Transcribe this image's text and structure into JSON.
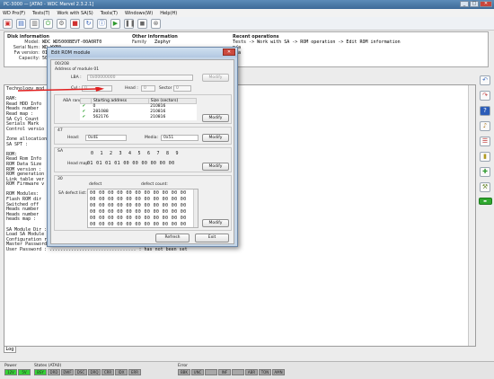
{
  "app": {
    "title": "PC-3000 — [ATA0 - WDC Marvel 2.3.2.1]",
    "menu": [
      "WD Pro(F)",
      "Tests(T)",
      "Work with SA(S)",
      "Tools(T)",
      "Windows(W)",
      "Help(H)"
    ]
  },
  "info_panel": {
    "disk_header": "Disk information",
    "model_label": "Model:",
    "model_value": "WDC WD5000BEVT-00A0RT0",
    "serial_label": "Serial Num:",
    "serial_value": "WD-WXE0...",
    "fw_label": "Fw version:",
    "fw_value": "01.01A01",
    "capacity_label": "Capacity:",
    "capacity_value": "500 GB",
    "other_header": "Other information",
    "family_label": "Family",
    "family_value": "Zephyr",
    "recent_header": "Recent operations",
    "recent_line1": "Tests -> Work with SA -> ROM operation -> Edit ROM information",
    "recent_line2": "n/a",
    "recent_line3": "n/a"
  },
  "log_lines": [
    "Technology mod",
    "",
    "RAM:",
    "Read HDD Info",
    "Heads number",
    "Read map :",
    "SA Cyl Count",
    "Serials Mark",
    "Control versio",
    "",
    "Zone allocation",
    "SA SPT :",
    "",
    "ROM:",
    "Read Rom Info",
    "ROM Data Size",
    "ROM version :",
    "ROM generation",
    "Link table ver",
    "ROM Firmware v",
    "",
    "ROM Modules:",
    "Flash ROM dir",
    "Switched off",
    "Heads number",
    "Heads number",
    "heads map :",
    "",
    "SA Module Dir : ................................ : OK",
    "Load SA Module Dir ............................. : OK",
    "Configuration reading : ........................ : OK",
    "Master Password : .............................. : has not been set",
    "User Password : ................................ : has not been set"
  ],
  "dialog": {
    "title": "Edit ROM module",
    "module_path": "00/208",
    "address_caption": "Address of module 01",
    "lba_label": "LBA :",
    "lba_value": "0x00000000",
    "cyl_label": "Cyl :",
    "cyl_value": "0",
    "head_label": "Head :",
    "head_value": "0",
    "sector_label": "Sector :",
    "sector_value": "0",
    "modify1": "Modify",
    "aba_label": "ABA range:",
    "aba_columns": [
      "Starting address",
      "Size (sectors)"
    ],
    "aba_rows": [
      {
        "start": "0",
        "size": "210816"
      },
      {
        "start": "281088",
        "size": "210816"
      },
      {
        "start": "562176",
        "size": "210816"
      }
    ],
    "modify2": "Modify",
    "section47": "47",
    "head_field_label": "Head:",
    "head_field_value": "0x4E",
    "media_label": "Media:",
    "media_value": "0x51",
    "modify3": "Modify",
    "section_sa": "SA",
    "heads_cols": [
      "0",
      "1",
      "2",
      "3",
      "4",
      "5",
      "6",
      "7",
      "8",
      "9"
    ],
    "head_map_label": "Head map:",
    "head_map_value": "01 01 01 01 00 00 00 00 00 00",
    "modify4": "Modify",
    "section30": "30",
    "defect_col1": "defect",
    "defect_col2": "defect count:",
    "sa_defect_label": "SA defect list:",
    "defect_rows": [
      "00 00 00 00 00 00 00 00 00 00 00",
      "00 00 00 00 00 00 00 00 00 00 00",
      "00 00 00 00 00 00 00 00 00 00 00",
      "00 00 00 00 00 00 00 00 00 00 00",
      "00 00 00 00 00 00 00 00 00 00 00",
      "00 00 00 00 00 00 00 00 00 00 00"
    ],
    "modify5": "Modify",
    "refresh": "Refresh",
    "exit": "Exit"
  },
  "log_tab": "Log",
  "status": {
    "power_label": "Power",
    "power_leds": [
      "12V",
      "5V"
    ],
    "states_label": "States (ATA0)",
    "state_leds": [
      "BSY",
      "DRD",
      "DWF",
      "DSC",
      "DRQ",
      "CRR",
      "IDX",
      "ERR"
    ],
    "error_label": "Error",
    "error_leds": [
      "BBK",
      "UNC",
      "",
      "INF",
      "",
      "ABR",
      "TON",
      "AMN"
    ],
    "accent_on": "#36d236"
  }
}
